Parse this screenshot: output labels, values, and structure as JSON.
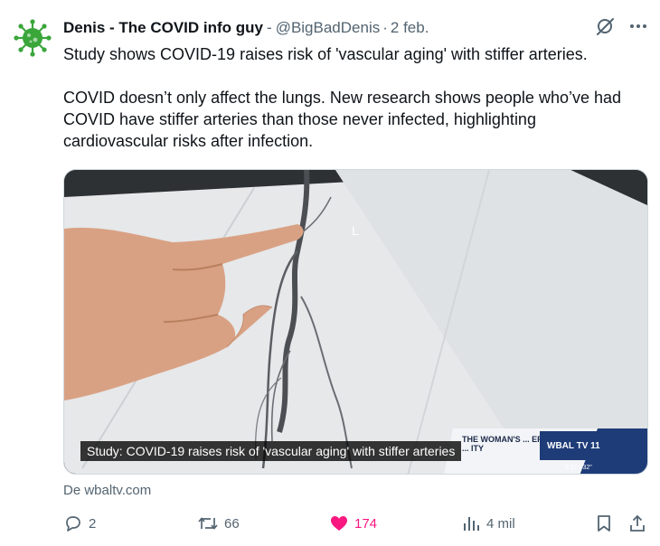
{
  "tweet": {
    "avatar_icon": "virus-icon",
    "avatar_color": "#3aa63a",
    "display_name": "Denis - The COVID info guy",
    "name_separator": "-",
    "handle": "@BigBadDenis",
    "dot": "·",
    "date": "2 feb.",
    "text_line1": "Study shows COVID-19 raises risk of 'vascular aging' with stiffer arteries.",
    "text_para2": "COVID doesn’t only affect the lungs. New research shows people who’ve had COVID have stiffer arteries than those never infected, highlighting cardiovascular risks after infection.",
    "top_icons": [
      "grok-icon",
      "more-icon"
    ]
  },
  "media": {
    "caption": "Study: COVID-19 raises risk of 'vascular aging' with stiffer arteries",
    "chyron_title": "THE WOMAN'S ... ER ... ITY",
    "station": "WBAL TV 11",
    "time": "5:27 / 32\""
  },
  "source": "De wbaltv.com",
  "actions": {
    "reply_count": "2",
    "repost_count": "66",
    "like_count": "174",
    "views_count": "4 mil",
    "like_color": "#f91880"
  }
}
